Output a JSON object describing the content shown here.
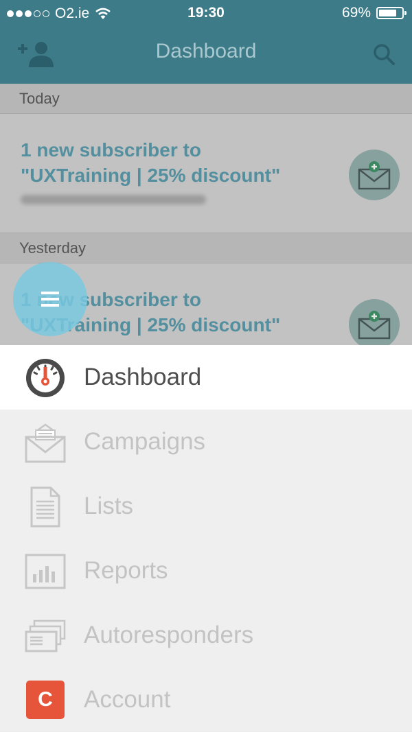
{
  "status_bar": {
    "carrier": "O2.ie",
    "time": "19:30",
    "battery": "69%",
    "battery_level": 0.69,
    "signal_bars_filled": 3,
    "signal_bars_total": 5
  },
  "header": {
    "title": "Dashboard",
    "add_user_icon": "add-user-icon",
    "search_icon": "search-icon"
  },
  "feed": {
    "sections": [
      {
        "heading": "Today",
        "items": [
          {
            "line1": "1 new subscriber to",
            "line2": "\"UXTraining | 25% discount\""
          }
        ]
      },
      {
        "heading": "Yesterday",
        "items": [
          {
            "line1": "1 new subscriber to",
            "line2": "\"UXTraining | 25% discount\""
          }
        ]
      }
    ]
  },
  "menu": {
    "items": [
      {
        "label": "Dashboard",
        "icon": "gauge-icon",
        "active": true
      },
      {
        "label": "Campaigns",
        "icon": "envelope-icon"
      },
      {
        "label": "Lists",
        "icon": "document-icon"
      },
      {
        "label": "Reports",
        "icon": "bar-chart-icon"
      },
      {
        "label": "Autoresponders",
        "icon": "stacked-envelopes-icon"
      },
      {
        "label": "Account",
        "icon": "account-badge-icon",
        "badge_letter": "C"
      }
    ]
  },
  "colors": {
    "header_bg": "#3e7b88",
    "link_text": "#4b94a6",
    "fab": "#78c8e1",
    "account_badge": "#e6553a",
    "gauge_needle": "#e6553a"
  }
}
